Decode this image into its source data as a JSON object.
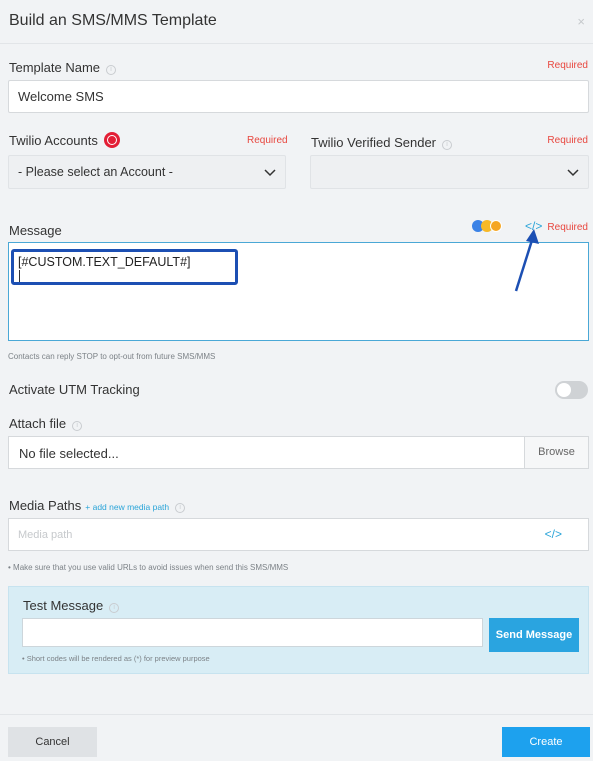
{
  "dialog": {
    "title": "Build an SMS/MMS Template",
    "close_glyph": "×"
  },
  "template_name": {
    "label": "Template Name",
    "required": "Required",
    "value": "Welcome SMS",
    "info_glyph": "i"
  },
  "twilio_accounts": {
    "label": "Twilio Accounts",
    "required": "Required",
    "selected": "- Please select an Account -",
    "icon": "twilio-logo-icon"
  },
  "verified_sender": {
    "label": "Twilio Verified Sender",
    "required": "Required",
    "selected": ""
  },
  "message": {
    "label": "Message",
    "required": "Required",
    "value": "[#CUSTOM.TEXT_DEFAULT#]",
    "code_glyph": "</>",
    "hint": "Contacts can reply STOP to opt-out from future SMS/MMS"
  },
  "utm": {
    "label": "Activate UTM Tracking",
    "enabled": false
  },
  "attach": {
    "label": "Attach file",
    "value": "No file selected...",
    "browse_label": "Browse"
  },
  "media_paths": {
    "label": "Media Paths",
    "add_link": "+ add new media path",
    "placeholder": "Media path",
    "code_glyph": "</>",
    "hint": "• Make sure that you use valid URLs to avoid issues when send this SMS/MMS"
  },
  "test_message": {
    "label": "Test Message",
    "value": "",
    "send_label": "Send Message",
    "hint": "• Short codes will be rendered as (*) for preview purpose"
  },
  "footer": {
    "cancel_label": "Cancel",
    "create_label": "Create"
  },
  "colors": {
    "required": "#e8473f",
    "accent": "#1da1ee",
    "highlight": "#1c4fb3",
    "twilio": "#e31e35"
  }
}
